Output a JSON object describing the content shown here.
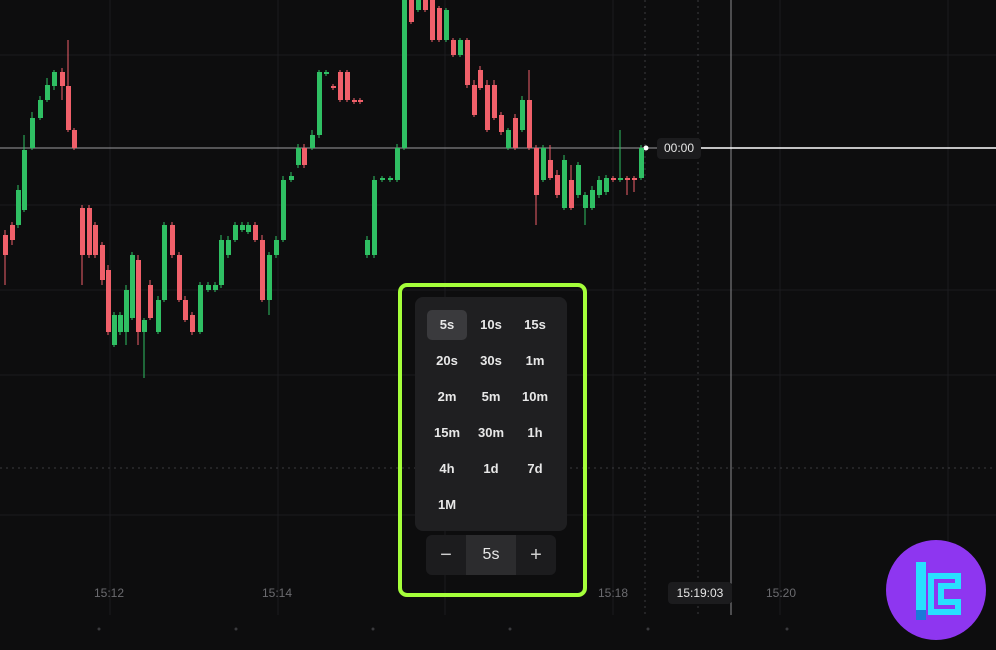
{
  "chart": {
    "price_tag": "00:00",
    "time_labels": [
      "15:12",
      "15:14",
      "15:18",
      "15:20"
    ],
    "current_time": "15:19:03",
    "colors": {
      "up": "#2fbf63",
      "down": "#f0606a",
      "crosshair": "#ffffff",
      "grid": "#1c1c1f"
    }
  },
  "timeframe_picker": {
    "options": [
      "5s",
      "10s",
      "15s",
      "20s",
      "30s",
      "1m",
      "2m",
      "5m",
      "10m",
      "15m",
      "30m",
      "1h",
      "4h",
      "1d",
      "7d",
      "1M"
    ],
    "selected": "5s",
    "stepper": {
      "minus_label": "−",
      "value": "5s",
      "plus_label": "+"
    },
    "highlight_color": "#a5ff3a"
  },
  "logo": {
    "icon": "brand-logo-icon",
    "color": "#8e36f0"
  }
}
